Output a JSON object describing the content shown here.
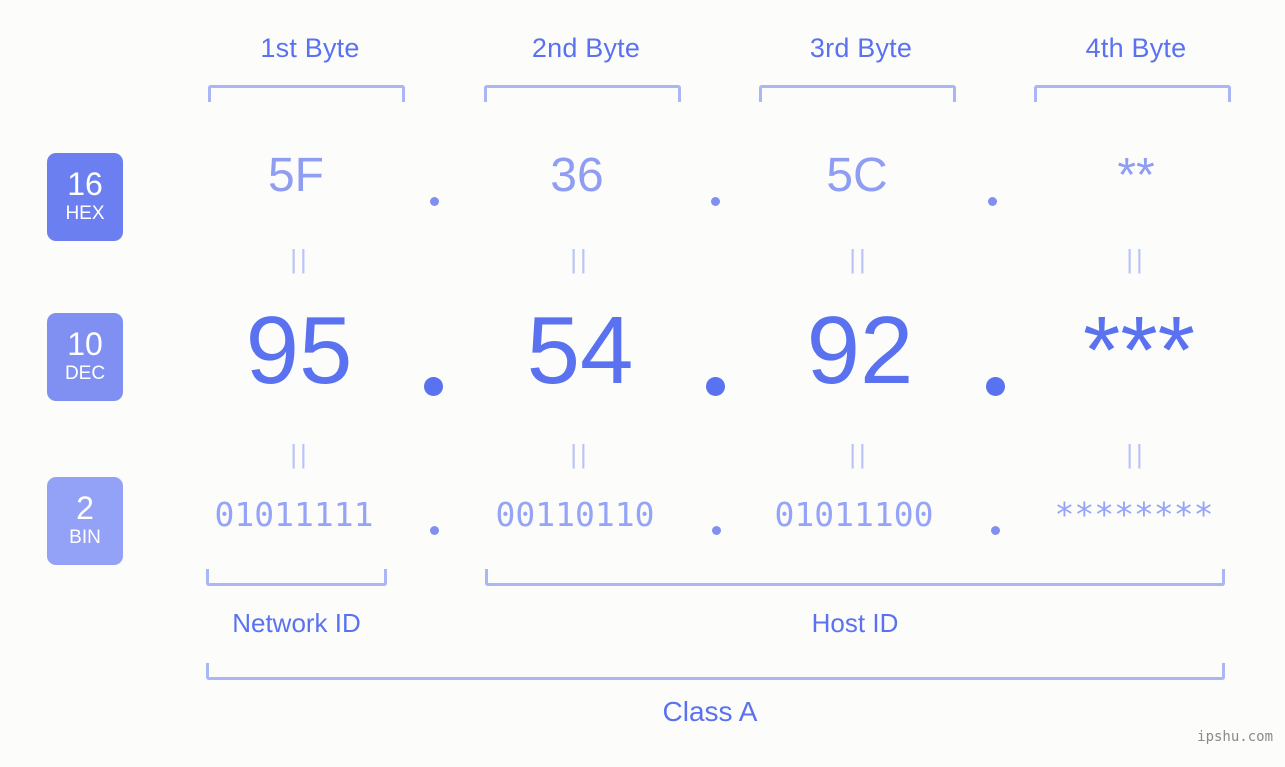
{
  "page": {
    "background": "#fcfdfa",
    "accent": "#5a72f0",
    "accent_light": "#aab6f5",
    "watermark": "ipshu.com"
  },
  "header": {
    "byte_labels": [
      {
        "label": "1st Byte"
      },
      {
        "label": "2nd Byte"
      },
      {
        "label": "3rd Byte"
      },
      {
        "label": "4th Byte"
      }
    ]
  },
  "radix_badges": [
    {
      "num": "16",
      "word": "HEX",
      "color": "#6c7ff0"
    },
    {
      "num": "10",
      "word": "DEC",
      "color": "#8090f2"
    },
    {
      "num": "2",
      "word": "BIN",
      "color": "#93a2f6"
    }
  ],
  "rows": {
    "hex": {
      "radix": "16",
      "name": "HEX",
      "values": [
        "5F",
        "36",
        "5C",
        "**"
      ],
      "separator": "."
    },
    "dec": {
      "radix": "10",
      "name": "DEC",
      "values": [
        "95",
        "54",
        "92",
        "***"
      ],
      "separator": "."
    },
    "bin": {
      "radix": "2",
      "name": "BIN",
      "values": [
        "01011111",
        "00110110",
        "01011100",
        "********"
      ],
      "separator": "."
    }
  },
  "equality_marks": {
    "glyph": "||",
    "hex_to_dec": [
      "||",
      "||",
      "||",
      "||"
    ],
    "dec_to_bin": [
      "||",
      "||",
      "||",
      "||"
    ]
  },
  "footer": {
    "network_id_label": "Network ID",
    "host_id_label": "Host ID",
    "class_label": "Class A"
  }
}
